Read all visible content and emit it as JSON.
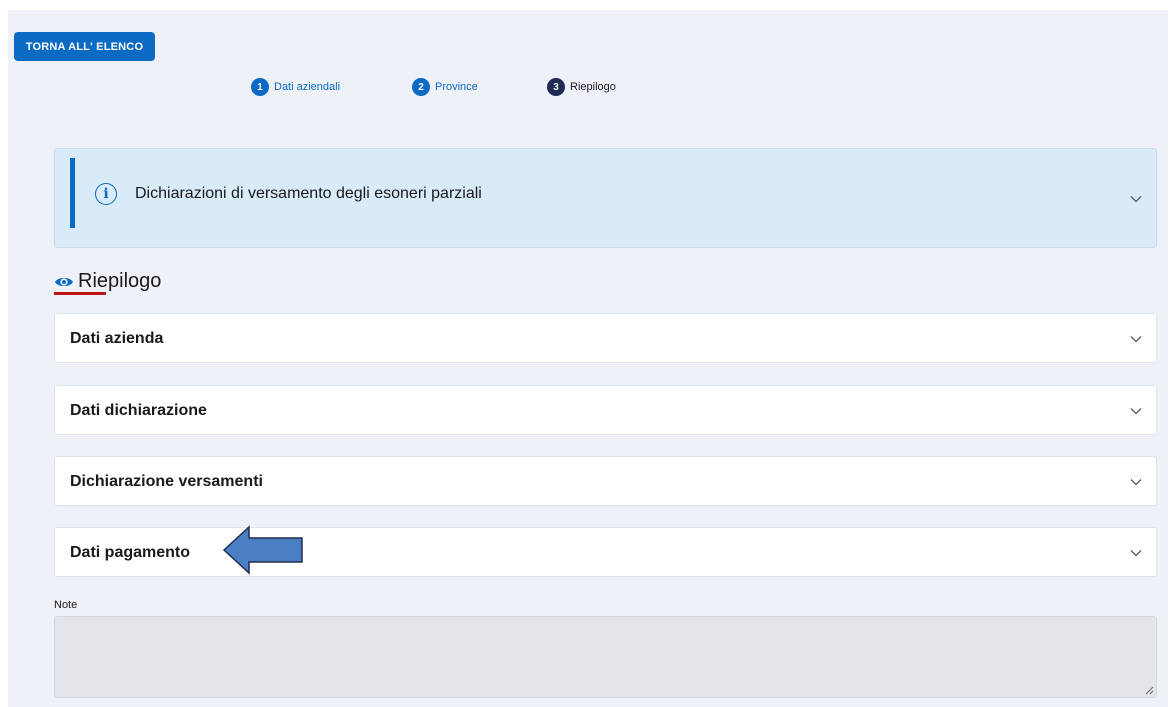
{
  "back_button": {
    "label": "TORNA ALL' ELENCO"
  },
  "stepper": {
    "steps": [
      {
        "number": "1",
        "label": "Dati aziendali",
        "state": "completed"
      },
      {
        "number": "2",
        "label": "Province",
        "state": "completed"
      },
      {
        "number": "3",
        "label": "Riepilogo",
        "state": "active"
      }
    ]
  },
  "info_banner": {
    "title": "Dichiarazioni di versamento degli esoneri parziali",
    "icon": "info-icon"
  },
  "summary": {
    "title": "Riepilogo",
    "icon": "eye-icon",
    "sections": [
      {
        "label": "Dati azienda"
      },
      {
        "label": "Dati dichiarazione"
      },
      {
        "label": "Dichiarazione versamenti"
      },
      {
        "label": "Dati pagamento"
      }
    ]
  },
  "notes": {
    "label": "Note",
    "value": ""
  },
  "colors": {
    "primary": "#0b6ac4",
    "active_step": "#1f2a55",
    "banner_bg": "#d9ebf8",
    "accent_underline": "#c0141b",
    "arrow_fill": "#4a7fc4"
  }
}
